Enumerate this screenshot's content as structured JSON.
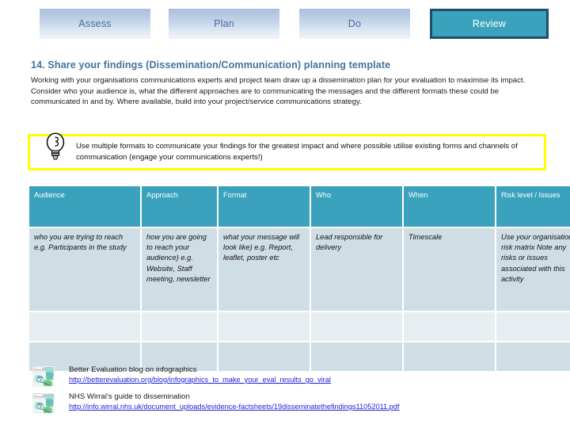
{
  "nav": {
    "tabs": [
      {
        "label": "Assess",
        "state": "inactive"
      },
      {
        "label": "Plan",
        "state": "inactive"
      },
      {
        "label": "Do",
        "state": "inactive"
      },
      {
        "label": "Review",
        "state": "active"
      }
    ],
    "active_color": "#3ba2bd",
    "active_border_color": "#1f4e66",
    "inactive_text_color": "#4a6f9b"
  },
  "header": {
    "title": "14. Share your findings (Dissemination/Communication) planning template",
    "title_color": "#43749e",
    "intro": "Working with your organisations communications experts and project team draw up a dissemination plan for your evaluation to maximise its impact.   Consider who your audience is, what the different approaches are to communicating the messages and the different formats these could be communicated in and by.  Where available, build into your project/service communications strategy."
  },
  "tip": {
    "icon": "lightbulb-icon",
    "border_color": "#ffff00",
    "text": "Use multiple formats to communicate your findings for the greatest impact and where possible utilise existing forms and channels of communication (engage your communications experts!)"
  },
  "table": {
    "header_color": "#3ba2bd",
    "guide_row_color": "#cfdee4",
    "columns": [
      "Audience",
      "Approach",
      "Format",
      "Who",
      "When",
      "Risk level / Issues"
    ],
    "guide_row": [
      "who you are trying to reach e.g. Participants in the study",
      "how you are going to reach your audience) e.g. Website, Staff meeting, newsletter",
      "what your message will look like) e.g. Report, leaflet, poster etc",
      "Lead responsible for delivery",
      "Timescale",
      "Use your organisations risk matrix\nNote any risks or issues associated with this activity"
    ],
    "empty_rows": 2
  },
  "resources": [
    {
      "thumb": "infographic-thumbnail-icon",
      "label": "Better Evaluation blog on infographics",
      "url": "http://betterevaluation.org/blog/infographics_to_make_your_eval_results_go_viral"
    },
    {
      "thumb": "infographic-thumbnail-icon",
      "label": "NHS Wirral’s guide to dissemination",
      "url": "http://info.wirral.nhs.uk/document_uploads/evidence-factsheets/19disseminatethefindings11052011.pdf"
    }
  ]
}
